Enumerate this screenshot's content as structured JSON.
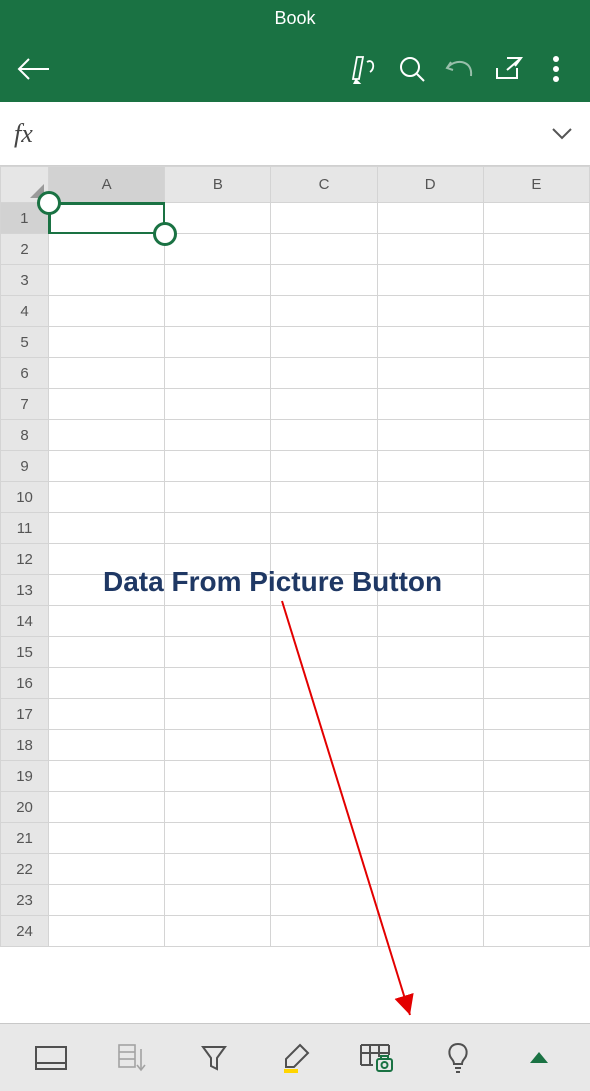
{
  "header": {
    "title": "Book",
    "icons": {
      "back": "back-arrow",
      "draw": "pen",
      "search": "magnifier",
      "undo": "undo",
      "share": "share",
      "more": "vertical-dots"
    }
  },
  "formula_bar": {
    "fx_label": "fx",
    "value": "",
    "placeholder": ""
  },
  "grid": {
    "columns": [
      "A",
      "B",
      "C",
      "D",
      "E"
    ],
    "rows": [
      "1",
      "2",
      "3",
      "4",
      "5",
      "6",
      "7",
      "8",
      "9",
      "10",
      "11",
      "12",
      "13",
      "14",
      "15",
      "16",
      "17",
      "18",
      "19",
      "20",
      "21",
      "22",
      "23",
      "24"
    ],
    "selected_cell": "A1"
  },
  "annotation": {
    "text": "Data From Picture Button"
  },
  "bottom_bar": {
    "icons": {
      "card_view": "card-view",
      "sort": "sort",
      "filter": "filter-funnel",
      "highlight": "highlighter",
      "data_from_picture": "table-camera",
      "ideas": "lightbulb",
      "expand": "expand-up"
    }
  }
}
